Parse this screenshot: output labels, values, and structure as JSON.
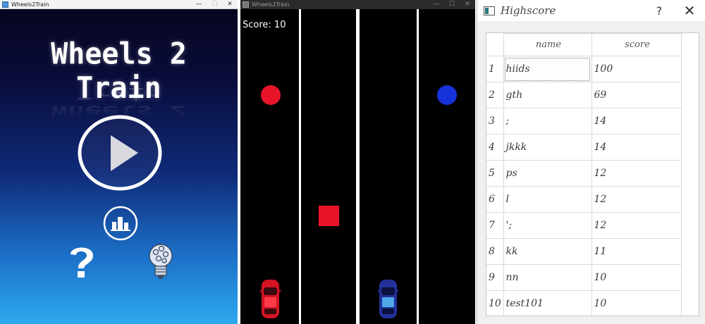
{
  "menu_window": {
    "title": "Wheels2Train",
    "min_glyph": "—",
    "max_glyph": "☐",
    "close_glyph": "✕",
    "game_title": "Wheels 2 Train",
    "buttons": [
      {
        "name": "play-icon"
      },
      {
        "name": "stats-icon"
      },
      {
        "name": "question-icon"
      },
      {
        "name": "lightbulb-icon"
      }
    ]
  },
  "game_window": {
    "title": "Wheels2Train",
    "min_glyph": "—",
    "max_glyph": "☐",
    "close_glyph": "✕",
    "score_text": "Score: 10",
    "colors": {
      "red": "#e8152a",
      "blue": "#1432d8",
      "lane_line": "#ffffff"
    }
  },
  "highscore_window": {
    "title": "Highscore",
    "help_glyph": "?",
    "close_glyph": "✕",
    "columns": [
      "name",
      "score"
    ],
    "rows": [
      {
        "num": "1",
        "name": "hiids",
        "score": "100"
      },
      {
        "num": "2",
        "name": "gth",
        "score": "69"
      },
      {
        "num": "3",
        "name": ";",
        "score": "14"
      },
      {
        "num": "4",
        "name": "jkkk",
        "score": "14"
      },
      {
        "num": "5",
        "name": "ps",
        "score": "12"
      },
      {
        "num": "6",
        "name": "l",
        "score": "12"
      },
      {
        "num": "7",
        "name": "';",
        "score": "12"
      },
      {
        "num": "8",
        "name": "kk",
        "score": "11"
      },
      {
        "num": "9",
        "name": "nn",
        "score": "10"
      },
      {
        "num": "10",
        "name": "test101",
        "score": "10"
      }
    ]
  }
}
